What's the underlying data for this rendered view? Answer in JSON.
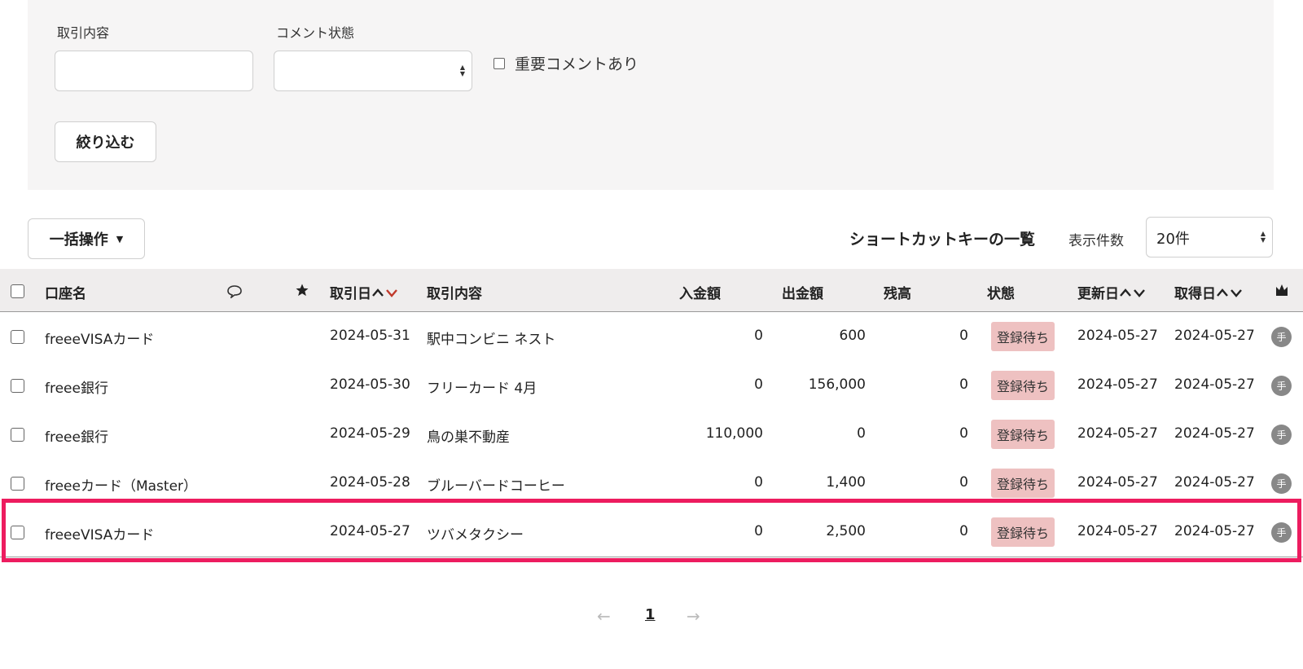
{
  "filter": {
    "transaction_label": "取引内容",
    "transaction_value": "",
    "comment_status_label": "コメント状態",
    "comment_status_value": "",
    "important_label": "重要コメントあり",
    "filter_button": "絞り込む"
  },
  "toolbar": {
    "bulk_button": "一括操作",
    "shortcut_link": "ショートカットキーの一覧",
    "per_page_label": "表示件数",
    "per_page_value": "20件"
  },
  "table": {
    "headers": {
      "account": "口座名",
      "date": "取引日",
      "description": "取引内容",
      "deposit": "入金額",
      "withdrawal": "出金額",
      "balance": "残高",
      "status": "状態",
      "updated": "更新日",
      "acquired": "取得日"
    },
    "rows": [
      {
        "account": "freeeVISAカード",
        "date": "2024-05-31",
        "description": "駅中コンビニ ネスト",
        "deposit": "0",
        "withdrawal": "600",
        "balance": "0",
        "status": "登録待ち",
        "updated": "2024-05-27",
        "acquired": "2024-05-27",
        "source": "手"
      },
      {
        "account": "freee銀行",
        "date": "2024-05-30",
        "description": "フリーカード 4月",
        "deposit": "0",
        "withdrawal": "156,000",
        "balance": "0",
        "status": "登録待ち",
        "updated": "2024-05-27",
        "acquired": "2024-05-27",
        "source": "手"
      },
      {
        "account": "freee銀行",
        "date": "2024-05-29",
        "description": "鳥の巣不動産",
        "deposit": "110,000",
        "withdrawal": "0",
        "balance": "0",
        "status": "登録待ち",
        "updated": "2024-05-27",
        "acquired": "2024-05-27",
        "source": "手"
      },
      {
        "account": "freeeカード（Master）",
        "date": "2024-05-28",
        "description": "ブルーバードコーヒー",
        "deposit": "0",
        "withdrawal": "1,400",
        "balance": "0",
        "status": "登録待ち",
        "updated": "2024-05-27",
        "acquired": "2024-05-27",
        "source": "手"
      },
      {
        "account": "freeeVISAカード",
        "date": "2024-05-27",
        "description": "ツバメタクシー",
        "deposit": "0",
        "withdrawal": "2,500",
        "balance": "0",
        "status": "登録待ち",
        "updated": "2024-05-27",
        "acquired": "2024-05-27",
        "source": "手"
      }
    ]
  },
  "pagination": {
    "prev": "←",
    "current": "1",
    "next": "→"
  },
  "colors": {
    "highlight": "#ed1c5f",
    "status_badge": "#eec1c1",
    "sort_active": "#c0392b"
  }
}
